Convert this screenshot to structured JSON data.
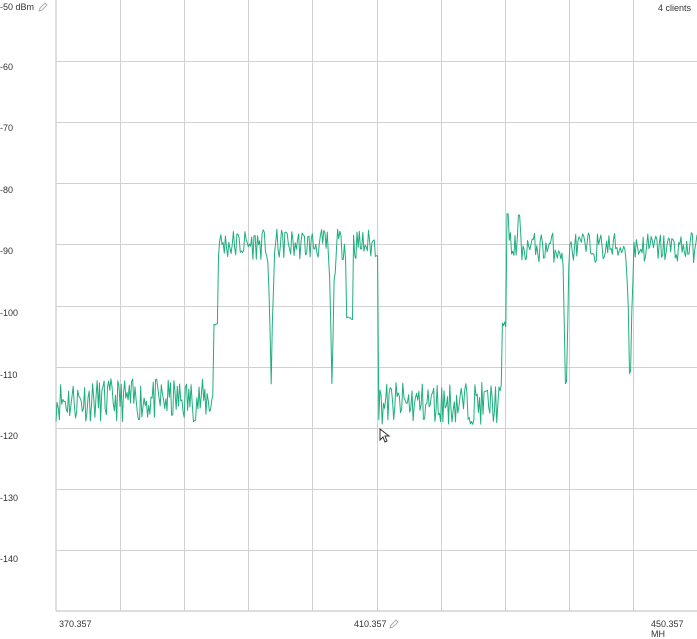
{
  "status": {
    "clients": "4 clients"
  },
  "icons": {
    "ref_edit": "pencil-icon",
    "center_edit": "pencil-icon",
    "pointer": "mouse-cursor-icon"
  },
  "colors": {
    "trace": "#1fae7e",
    "grid": "#d0d0d0",
    "background": "#ffffff"
  },
  "chart_data": {
    "type": "line",
    "title": "",
    "xlabel": "",
    "ylabel": "",
    "y_unit": "dBm",
    "x_unit": "MHz",
    "xlim": [
      370.357,
      450.357
    ],
    "ylim": [
      -150,
      -50
    ],
    "grid": true,
    "y_tick_labels": [
      "-50 dBm",
      "-60",
      "-70",
      "-80",
      "-90",
      "-100",
      "-110",
      "-120",
      "-130",
      "-140"
    ],
    "x_tick_labels": [
      "370.357",
      "410.357",
      "450.357 MH"
    ],
    "series": [
      {
        "segments": [
          {
            "from": 370.357,
            "to": 390.0,
            "level": -115.5,
            "noise": 3.5
          },
          {
            "from": 390.0,
            "to": 390.6,
            "level": -103,
            "noise": 0.5
          },
          {
            "from": 390.6,
            "to": 406.6,
            "level": -90,
            "noise": 2.5
          },
          {
            "from": 406.6,
            "to": 407.4,
            "level": -102,
            "noise": 0.5
          },
          {
            "from": 407.4,
            "to": 410.6,
            "level": -90,
            "noise": 2.5
          },
          {
            "from": 410.6,
            "to": 426.0,
            "level": -116,
            "noise": 3.5
          },
          {
            "from": 426.0,
            "to": 426.8,
            "level": -103,
            "noise": 0.5
          },
          {
            "from": 426.8,
            "to": 450.357,
            "level": -90.5,
            "noise": 2.5
          }
        ],
        "dips": [
          {
            "x": 397.2,
            "min": -114
          },
          {
            "x": 404.8,
            "min": -114
          },
          {
            "x": 434.0,
            "min": -119
          },
          {
            "x": 442.0,
            "min": -116.5
          }
        ],
        "peaks": [
          {
            "x": 399.0,
            "val": -88
          },
          {
            "x": 426.7,
            "val": -85
          },
          {
            "x": 428.2,
            "val": -85.2
          }
        ]
      }
    ]
  }
}
